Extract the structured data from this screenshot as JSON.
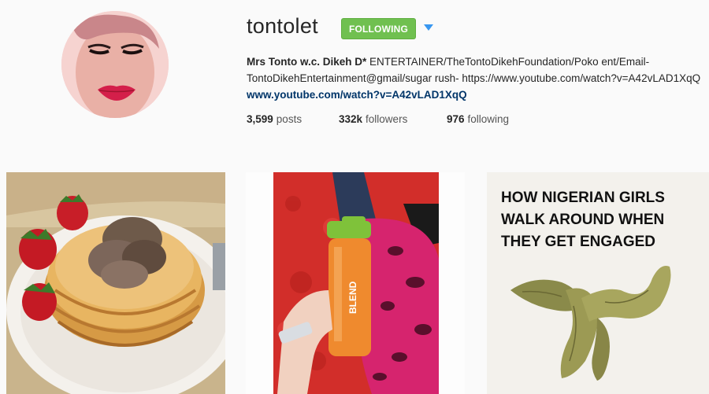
{
  "profile": {
    "username": "tontolet",
    "follow_button": "FOLLOWING",
    "dropdown_icon": "chevron-down-icon",
    "bio_name": "Mrs Tonto w.c. Dikeh D*",
    "bio_text": " ENTERTAINER/TheTontoDikehFoundation/Poko ent/Email-TontoDikehEntertainment@gmail/sugar rush- https://www.youtube.com/watch?v=A42vLAD1XqQ ",
    "bio_link": "www.youtube.com/watch?v=A42vLAD1XqQ"
  },
  "stats": {
    "posts_count": "3,599",
    "posts_label": "posts",
    "followers_count": "332k",
    "followers_label": "followers",
    "following_count": "976",
    "following_label": "following"
  },
  "posts": [
    {
      "subject": "pancakes with ice cream and strawberries"
    },
    {
      "subject": "hand holding orange Blend bottle"
    },
    {
      "meme_line1": "HOW NIGERIAN GIRLS",
      "meme_line2": "WALK AROUND WHEN",
      "meme_line3": "THEY GET ENGAGED"
    }
  ],
  "colors": {
    "follow_green": "#70c050",
    "link_blue": "#003569",
    "dropdown_blue": "#3897f0"
  }
}
